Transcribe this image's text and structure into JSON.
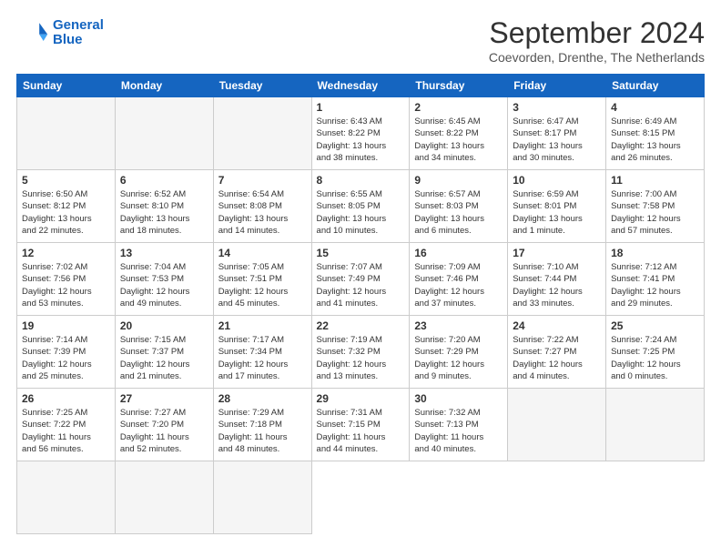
{
  "logo": {
    "line1": "General",
    "line2": "Blue"
  },
  "title": "September 2024",
  "location": "Coevorden, Drenthe, The Netherlands",
  "weekdays": [
    "Sunday",
    "Monday",
    "Tuesday",
    "Wednesday",
    "Thursday",
    "Friday",
    "Saturday"
  ],
  "days": [
    {
      "num": "",
      "info": ""
    },
    {
      "num": "",
      "info": ""
    },
    {
      "num": "",
      "info": ""
    },
    {
      "num": "1",
      "info": "Sunrise: 6:43 AM\nSunset: 8:22 PM\nDaylight: 13 hours\nand 38 minutes."
    },
    {
      "num": "2",
      "info": "Sunrise: 6:45 AM\nSunset: 8:22 PM\nDaylight: 13 hours\nand 34 minutes."
    },
    {
      "num": "3",
      "info": "Sunrise: 6:47 AM\nSunset: 8:17 PM\nDaylight: 13 hours\nand 30 minutes."
    },
    {
      "num": "4",
      "info": "Sunrise: 6:49 AM\nSunset: 8:15 PM\nDaylight: 13 hours\nand 26 minutes."
    },
    {
      "num": "5",
      "info": "Sunrise: 6:50 AM\nSunset: 8:12 PM\nDaylight: 13 hours\nand 22 minutes."
    },
    {
      "num": "6",
      "info": "Sunrise: 6:52 AM\nSunset: 8:10 PM\nDaylight: 13 hours\nand 18 minutes."
    },
    {
      "num": "7",
      "info": "Sunrise: 6:54 AM\nSunset: 8:08 PM\nDaylight: 13 hours\nand 14 minutes."
    },
    {
      "num": "8",
      "info": "Sunrise: 6:55 AM\nSunset: 8:05 PM\nDaylight: 13 hours\nand 10 minutes."
    },
    {
      "num": "9",
      "info": "Sunrise: 6:57 AM\nSunset: 8:03 PM\nDaylight: 13 hours\nand 6 minutes."
    },
    {
      "num": "10",
      "info": "Sunrise: 6:59 AM\nSunset: 8:01 PM\nDaylight: 13 hours\nand 1 minute."
    },
    {
      "num": "11",
      "info": "Sunrise: 7:00 AM\nSunset: 7:58 PM\nDaylight: 12 hours\nand 57 minutes."
    },
    {
      "num": "12",
      "info": "Sunrise: 7:02 AM\nSunset: 7:56 PM\nDaylight: 12 hours\nand 53 minutes."
    },
    {
      "num": "13",
      "info": "Sunrise: 7:04 AM\nSunset: 7:53 PM\nDaylight: 12 hours\nand 49 minutes."
    },
    {
      "num": "14",
      "info": "Sunrise: 7:05 AM\nSunset: 7:51 PM\nDaylight: 12 hours\nand 45 minutes."
    },
    {
      "num": "15",
      "info": "Sunrise: 7:07 AM\nSunset: 7:49 PM\nDaylight: 12 hours\nand 41 minutes."
    },
    {
      "num": "16",
      "info": "Sunrise: 7:09 AM\nSunset: 7:46 PM\nDaylight: 12 hours\nand 37 minutes."
    },
    {
      "num": "17",
      "info": "Sunrise: 7:10 AM\nSunset: 7:44 PM\nDaylight: 12 hours\nand 33 minutes."
    },
    {
      "num": "18",
      "info": "Sunrise: 7:12 AM\nSunset: 7:41 PM\nDaylight: 12 hours\nand 29 minutes."
    },
    {
      "num": "19",
      "info": "Sunrise: 7:14 AM\nSunset: 7:39 PM\nDaylight: 12 hours\nand 25 minutes."
    },
    {
      "num": "20",
      "info": "Sunrise: 7:15 AM\nSunset: 7:37 PM\nDaylight: 12 hours\nand 21 minutes."
    },
    {
      "num": "21",
      "info": "Sunrise: 7:17 AM\nSunset: 7:34 PM\nDaylight: 12 hours\nand 17 minutes."
    },
    {
      "num": "22",
      "info": "Sunrise: 7:19 AM\nSunset: 7:32 PM\nDaylight: 12 hours\nand 13 minutes."
    },
    {
      "num": "23",
      "info": "Sunrise: 7:20 AM\nSunset: 7:29 PM\nDaylight: 12 hours\nand 9 minutes."
    },
    {
      "num": "24",
      "info": "Sunrise: 7:22 AM\nSunset: 7:27 PM\nDaylight: 12 hours\nand 4 minutes."
    },
    {
      "num": "25",
      "info": "Sunrise: 7:24 AM\nSunset: 7:25 PM\nDaylight: 12 hours\nand 0 minutes."
    },
    {
      "num": "26",
      "info": "Sunrise: 7:25 AM\nSunset: 7:22 PM\nDaylight: 11 hours\nand 56 minutes."
    },
    {
      "num": "27",
      "info": "Sunrise: 7:27 AM\nSunset: 7:20 PM\nDaylight: 11 hours\nand 52 minutes."
    },
    {
      "num": "28",
      "info": "Sunrise: 7:29 AM\nSunset: 7:18 PM\nDaylight: 11 hours\nand 48 minutes."
    },
    {
      "num": "29",
      "info": "Sunrise: 7:31 AM\nSunset: 7:15 PM\nDaylight: 11 hours\nand 44 minutes."
    },
    {
      "num": "30",
      "info": "Sunrise: 7:32 AM\nSunset: 7:13 PM\nDaylight: 11 hours\nand 40 minutes."
    },
    {
      "num": "",
      "info": ""
    },
    {
      "num": "",
      "info": ""
    },
    {
      "num": "",
      "info": ""
    },
    {
      "num": "",
      "info": ""
    },
    {
      "num": "",
      "info": ""
    }
  ]
}
